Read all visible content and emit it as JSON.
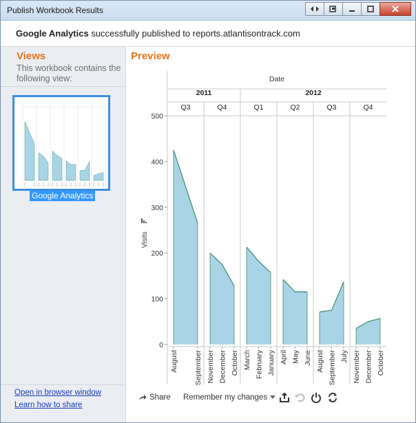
{
  "window": {
    "title": "Publish Workbook Results"
  },
  "banner": {
    "bold": "Google Analytics",
    "text": " successfully published to reports.atlantisontrack.com"
  },
  "sidebar": {
    "heading": "Views",
    "description": "This workbook contains the following view:",
    "view_name": "Google Analytics",
    "links": [
      "Open in browser window",
      "Learn how to share"
    ]
  },
  "preview": {
    "heading": "Preview"
  },
  "chart_data": {
    "type": "area",
    "title": "",
    "top_header": "Date",
    "ylabel": "Visits",
    "ylim": [
      0,
      500
    ],
    "yticks": [
      0,
      100,
      200,
      300,
      400,
      500
    ],
    "years": [
      {
        "label": "2011",
        "quarters": [
          "Q3",
          "Q4"
        ]
      },
      {
        "label": "2012",
        "quarters": [
          "Q1",
          "Q2",
          "Q3",
          "Q4"
        ]
      }
    ],
    "panes": [
      {
        "year": "2011",
        "quarter": "Q3",
        "months": [
          "August",
          "September"
        ],
        "values": [
          425,
          265
        ]
      },
      {
        "year": "2011",
        "quarter": "Q4",
        "months": [
          "November",
          "December",
          "October"
        ],
        "values": [
          200,
          175,
          128
        ]
      },
      {
        "year": "2012",
        "quarter": "Q1",
        "months": [
          "March",
          "February",
          "January"
        ],
        "values": [
          213,
          182,
          157
        ]
      },
      {
        "year": "2012",
        "quarter": "Q2",
        "months": [
          "April",
          "May",
          "June"
        ],
        "values": [
          142,
          115,
          115
        ]
      },
      {
        "year": "2012",
        "quarter": "Q3",
        "months": [
          "August",
          "September",
          "July"
        ],
        "values": [
          71,
          75,
          137
        ]
      },
      {
        "year": "2012",
        "quarter": "Q4",
        "months": [
          "November",
          "December",
          "October"
        ],
        "values": [
          35,
          50,
          57
        ]
      }
    ],
    "fill_color": "#a8d4e6",
    "line_color": "#3d8b6e"
  },
  "toolbar": {
    "share": "Share",
    "remember": "Remember my changes"
  }
}
